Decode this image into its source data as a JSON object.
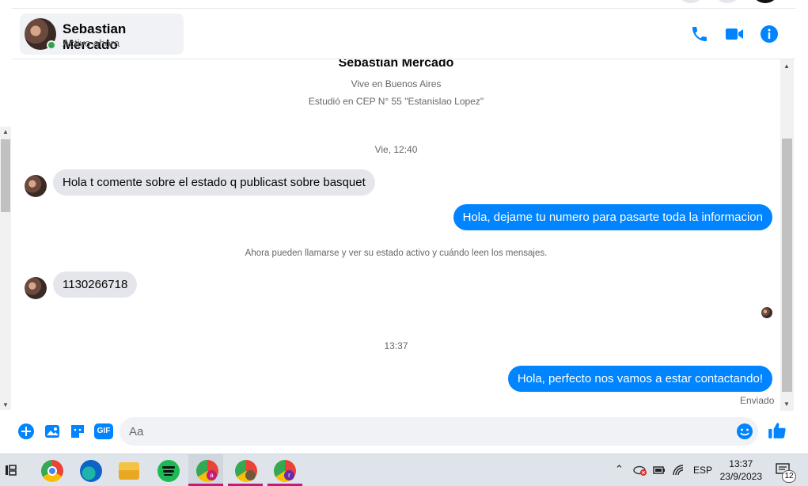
{
  "header": {
    "name": "Sebastian Mercado",
    "status": "Activo ahora",
    "icons": [
      "phone-icon",
      "video-icon",
      "info-icon"
    ]
  },
  "profile": {
    "name": "Sebastian Mercado",
    "line1": "Vive en Buenos Aires",
    "line2": "Estudió en CEP N° 55 \"Estanislao Lopez\""
  },
  "messages": {
    "ts1": "Vie, 12:40",
    "m1": "Hola t comente sobre el estado q publicast sobre basquet",
    "m2": "Hola, dejame tu numero para pasarte toda la informacion",
    "notice": "Ahora pueden llamarse y ver su estado activo y cuándo leen los mensajes.",
    "m3": "1130266718",
    "ts2": "13:37",
    "m4": "Hola, perfecto nos vamos a estar contactando!",
    "sent": "Enviado"
  },
  "composer": {
    "placeholder": "Aa",
    "icons": [
      "plus-icon",
      "image-icon",
      "sticker-icon",
      "gif-icon",
      "emoji-icon",
      "like-icon"
    ],
    "gif_label": "GIF"
  },
  "taskbar": {
    "apps": [
      "task-view-icon",
      "chrome-icon",
      "edge-icon",
      "file-explorer-icon",
      "spotify-icon",
      "chrome-profile-a-icon",
      "chrome-profile-photo-icon",
      "chrome-profile-r-icon"
    ],
    "lang": "ESP",
    "time": "13:37",
    "date": "23/9/2023",
    "notif_count": "12"
  },
  "colors": {
    "accent": "#0084ff",
    "incoming": "#e4e6eb",
    "online": "#31a24c"
  }
}
